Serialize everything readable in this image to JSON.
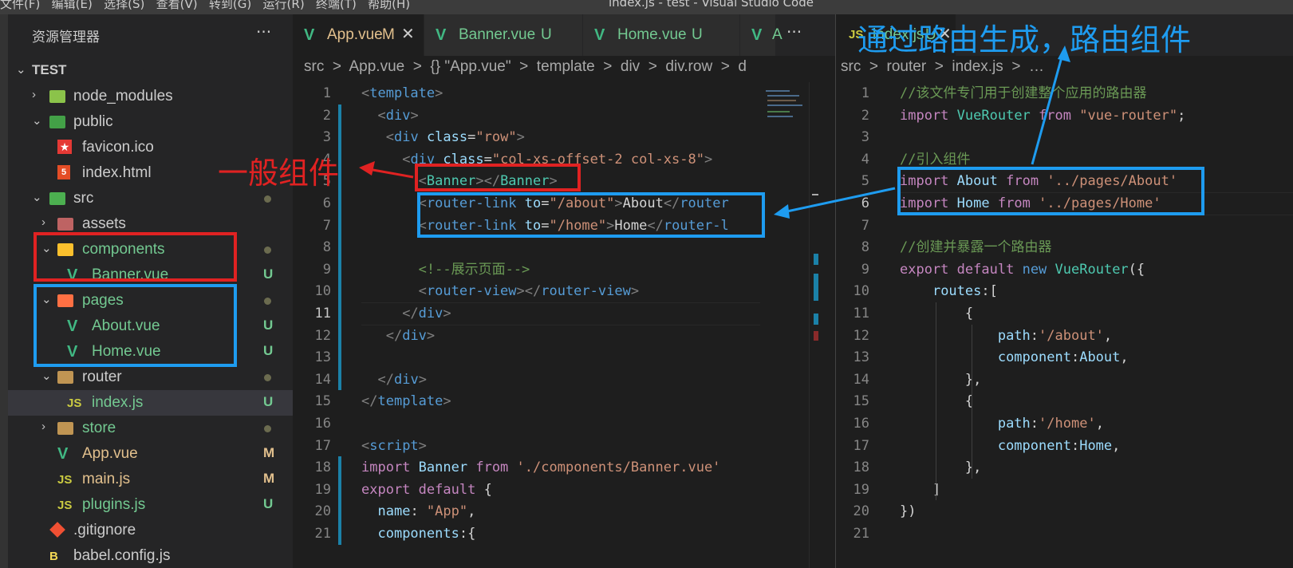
{
  "menubar": {
    "items": "文件(F)   编辑(E)   选择(S)   查看(V)   转到(G)   运行(R)   终端(T)   帮助(H)",
    "window_title": "index.js - test - Visual Studio Code"
  },
  "explorer": {
    "title": "资源管理器",
    "more": "···",
    "root": "TEST",
    "items": [
      {
        "label": "node_modules",
        "status": ""
      },
      {
        "label": "public",
        "status": ""
      },
      {
        "label": "favicon.ico",
        "status": ""
      },
      {
        "label": "index.html",
        "status": ""
      },
      {
        "label": "src",
        "status": ""
      },
      {
        "label": "assets",
        "status": ""
      },
      {
        "label": "components",
        "status": ""
      },
      {
        "label": "Banner.vue",
        "status": "U"
      },
      {
        "label": "pages",
        "status": ""
      },
      {
        "label": "About.vue",
        "status": "U"
      },
      {
        "label": "Home.vue",
        "status": "U"
      },
      {
        "label": "router",
        "status": ""
      },
      {
        "label": "index.js",
        "status": "U"
      },
      {
        "label": "store",
        "status": ""
      },
      {
        "label": "App.vue",
        "status": "M"
      },
      {
        "label": "main.js",
        "status": "M"
      },
      {
        "label": "plugins.js",
        "status": "U"
      },
      {
        "label": ".gitignore",
        "status": ""
      },
      {
        "label": "babel.config.js",
        "status": ""
      }
    ]
  },
  "editor1": {
    "tabs": [
      {
        "label": "App.vue",
        "status": "M",
        "close": "✕"
      },
      {
        "label": "Banner.vue",
        "status": "U"
      },
      {
        "label": "Home.vue",
        "status": "U"
      },
      {
        "label": "A",
        "status": ""
      }
    ],
    "tabs_more": "···",
    "breadcrumb": "src  >  App.vue  >  {} \"App.vue\"  >  template  >  div  >  div.row  >  d",
    "line_numbers": [
      "1",
      "2",
      "3",
      "4",
      "5",
      "6",
      "7",
      "8",
      "9",
      "10",
      "11",
      "12",
      "13",
      "14",
      "15",
      "16",
      "17",
      "18",
      "19",
      "20",
      "21"
    ],
    "lines": [
      "<template>",
      "  <div>",
      "   <div class=\"row\">",
      "     <div class=\"col-xs-offset-2 col-xs-8\">",
      "       <Banner></Banner>",
      "       <router-link to=\"/about\">About</router",
      "       <router-link to=\"/home\">Home</router-l",
      "",
      "       <!--展示页面-->",
      "       <router-view></router-view>",
      "     </div>",
      "   </div>",
      "",
      "  </div>",
      "</template>",
      "",
      "<script>",
      "import Banner from './components/Banner.vue'",
      "export default {",
      "  name: \"App\",",
      "  components:{"
    ]
  },
  "editor2": {
    "tab": {
      "label": "index.js",
      "status": "U",
      "close": "✕"
    },
    "breadcrumb": "src  >  router  >  index.js  >  …",
    "line_numbers": [
      "1",
      "2",
      "3",
      "4",
      "5",
      "6",
      "7",
      "8",
      "9",
      "10",
      "11",
      "12",
      "13",
      "14",
      "15",
      "16",
      "17",
      "18",
      "19",
      "20",
      "21"
    ],
    "lines": [
      "//该文件专门用于创建整个应用的路由器",
      "import VueRouter from \"vue-router\";",
      "",
      "//引入组件",
      "import About from '../pages/About'",
      "import Home from '../pages/Home'",
      "",
      "//创建并暴露一个路由器",
      "export default new VueRouter({",
      "    routes:[",
      "        {",
      "            path:'/about',",
      "            component:About,",
      "        },",
      "        {",
      "            path:'/home',",
      "            component:Home,",
      "        },",
      "    ]",
      "})",
      ""
    ]
  },
  "annotations": {
    "general_component": "一般组件",
    "route_component": "通过路由生成，路由组件",
    "red_color": "#e02222",
    "blue_color": "#1e9cf0"
  },
  "colors": {
    "vue_green": "#41b883",
    "modified": "#e2c08d",
    "untracked": "#73c991",
    "js_yellow": "#cbcb41"
  }
}
